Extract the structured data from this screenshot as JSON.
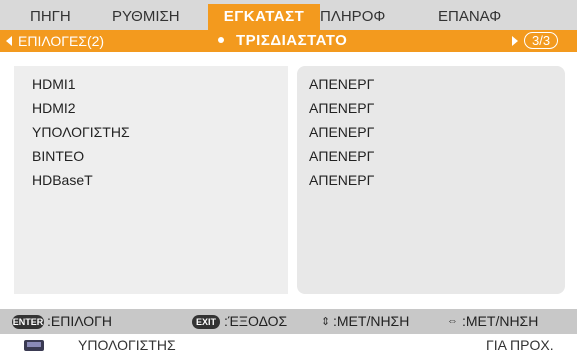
{
  "tabs": [
    {
      "label": "ΠΗΓΗ",
      "active": false
    },
    {
      "label": "ΡΥΘΜΙΣΗ",
      "active": false
    },
    {
      "label": "ΕΓΚΑΤΑΣΤ",
      "active": true
    },
    {
      "label": "ΠΛΗΡΟΦ",
      "active": false
    },
    {
      "label": "ΕΠΑΝΑΦ",
      "active": false
    }
  ],
  "subtabs": {
    "left": "ΕΠΙΛΟΓΕΣ(2)",
    "center": "ΤΡΙΣΔΙΑΣΤΑΤΟ",
    "page": "3/3"
  },
  "settings": [
    {
      "label": "HDMI1",
      "value": "ΑΠΕΝΕΡΓ"
    },
    {
      "label": "HDMI2",
      "value": "ΑΠΕΝΕΡΓ"
    },
    {
      "label": "ΥΠΟΛΟΓΙΣΤΗΣ",
      "value": "ΑΠΕΝΕΡΓ"
    },
    {
      "label": "ΒΙΝΤΕΟ",
      "value": "ΑΠΕΝΕΡΓ"
    },
    {
      "label": "HDBaseT",
      "value": "ΑΠΕΝΕΡΓ"
    }
  ],
  "help": {
    "enter_key": "ENTER",
    "enter_text": ":ΕΠΙΛΟΓΗ",
    "exit_key": "EXIT",
    "exit_text": ":ΈΞΟΔΟΣ",
    "updown_text": ":ΜΕΤ/ΝΗΣΗ",
    "leftright_text": ":ΜΕΤ/ΝΗΣΗ"
  },
  "status": {
    "source": "ΥΠΟΛΟΓΙΣΤΗΣ",
    "right": "ΓΙΑ ΠΡΟΧ.",
    "source_icon": "computer-monitor-icon"
  },
  "colors": {
    "accent": "#f39a1e",
    "tabbar": "#d9d9d9",
    "helpbar": "#c8c8c8"
  }
}
